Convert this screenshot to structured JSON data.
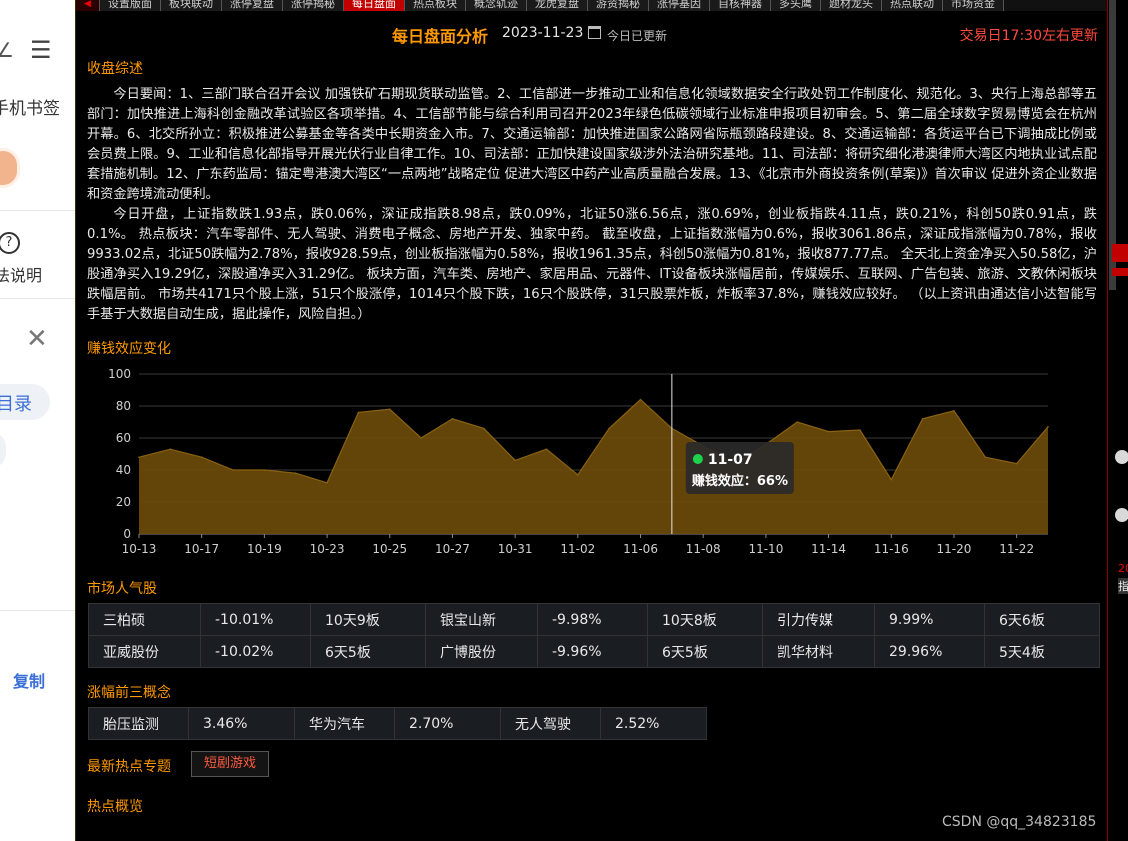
{
  "left_panel": {
    "menu_icon": "menu-icon",
    "bookmark_text": "手机书签",
    "help_text": "法说明",
    "close_icon": "close-icon",
    "catalog_text": "目录",
    "copy_text": "复制"
  },
  "tabs": [
    "设置版面",
    "板块联动",
    "涨停复盘",
    "涨停揭秘",
    "每日盘面",
    "热点板块",
    "概念轨迹",
    "龙虎复盘",
    "游资揭秘",
    "涨停基因",
    "自核神器",
    "多头鹰",
    "题材龙头",
    "热点联动",
    "市场资金"
  ],
  "active_tab": 4,
  "header": {
    "title": "每日盘面分析",
    "date": "2023-11-23",
    "updated": "今日已更新",
    "update_note": "交易日17:30左右更新"
  },
  "summary": {
    "title": "收盘综述",
    "news": "今日要闻：1、三部门联合召开会议 加强铁矿石期现货联动监管。2、工信部进一步推动工业和信息化领域数据安全行政处罚工作制度化、规范化。3、央行上海总部等五部门：加快推进上海科创金融改革试验区各项举措。4、工信部节能与综合利用司召开2023年绿色低碳领域行业标准申报项目初审会。5、第二届全球数字贸易博览会在杭州开幕。6、北交所孙立：积极推进公募基金等各类中长期资金入市。7、交通运输部：加快推进国家公路网省际瓶颈路段建设。8、交通运输部：各货运平台已下调抽成比例或会员费上限。9、工业和信息化部指导开展光伏行业自律工作。10、司法部：正加快建设国家级涉外法治研究基地。11、司法部：将研究细化港澳律师大湾区内地执业试点配套措施机制。12、广东药监局：锚定粤港澳大湾区“一点两地”战略定位 促进大湾区中药产业高质量融合发展。13、《北京市外商投资条例(草案)》首次审议 促进外资企业数据和资金跨境流动便利。",
    "market": "今日开盘，上证指数跌1.93点，跌0.06%，深证成指跌8.98点，跌0.09%，北证50涨6.56点，涨0.69%，创业板指跌4.11点，跌0.21%，科创50跌0.91点，跌0.1%。 热点板块：汽车零部件、无人驾驶、消费电子概念、房地产开发、独家中药。 截至收盘，上证指数涨幅为0.6%，报收3061.86点，深证成指涨幅为0.78%，报收9933.02点，北证50跌幅为2.78%，报收928.59点，创业板指涨幅为0.58%，报收1961.35点，科创50涨幅为0.81%，报收877.77点。 全天北上资金净买入50.58亿，沪股通净买入19.29亿，深股通净买入31.29亿。 板块方面，汽车类、房地产、家居用品、元器件、IT设备板块涨幅居前，传媒娱乐、互联网、广告包装、旅游、文教休闲板块跌幅居前。 市场共4171只个股上涨，51只个股涨停，1014只个股下跌，16只个股跌停，31只股票炸板，炸板率37.8%，赚钱效应较好。 （以上资讯由通达信小达智能写手基于大数据自动生成，据此操作，风险自担。）"
  },
  "chart_section": {
    "title": "赚钱效应变化"
  },
  "chart_data": {
    "type": "area",
    "x": [
      "10-13",
      "10-16",
      "10-17",
      "10-18",
      "10-19",
      "10-20",
      "10-23",
      "10-24",
      "10-25",
      "10-26",
      "10-27",
      "10-30",
      "10-31",
      "11-01",
      "11-02",
      "11-03",
      "11-06",
      "11-07",
      "11-08",
      "11-09",
      "11-10",
      "11-13",
      "11-14",
      "11-15",
      "11-16",
      "11-17",
      "11-20",
      "11-21",
      "11-22",
      "11-23"
    ],
    "y": [
      48,
      53,
      48,
      40,
      40,
      38,
      32,
      76,
      78,
      60,
      72,
      66,
      46,
      53,
      37,
      66,
      84,
      66,
      55,
      44,
      56,
      70,
      64,
      65,
      34,
      72,
      77,
      48,
      44,
      67
    ],
    "xticks": [
      "10-13",
      "10-17",
      "10-19",
      "10-23",
      "10-25",
      "10-27",
      "10-31",
      "11-02",
      "11-06",
      "11-08",
      "11-10",
      "11-14",
      "11-16",
      "11-20",
      "11-22"
    ],
    "yticks": [
      0,
      20,
      40,
      60,
      80,
      100
    ],
    "ylim": [
      0,
      100
    ],
    "grid": true,
    "tooltip": {
      "date": "11-07",
      "label": "赚钱效应：",
      "value": "66%"
    },
    "fill_color": "#6b4a0a",
    "line_color": "#8a6212"
  },
  "popularity": {
    "title": "市场人气股",
    "rows": [
      [
        {
          "name": "三柏硕",
          "change": "-10.01%",
          "board": "10天9板"
        },
        {
          "name": "银宝山新",
          "change": "-9.98%",
          "board": "10天8板"
        },
        {
          "name": "引力传媒",
          "change": "9.99%",
          "board": "6天6板"
        }
      ],
      [
        {
          "name": "亚威股份",
          "change": "-10.02%",
          "board": "6天5板"
        },
        {
          "name": "广博股份",
          "change": "-9.96%",
          "board": "6天5板"
        },
        {
          "name": "凯华材料",
          "change": "29.96%",
          "board": "5天4板"
        }
      ]
    ]
  },
  "concepts": {
    "title": "涨幅前三概念",
    "items": [
      {
        "name": "胎压监测",
        "change": "3.46%"
      },
      {
        "name": "华为汽车",
        "change": "2.70%"
      },
      {
        "name": "无人驾驶",
        "change": "2.52%"
      }
    ]
  },
  "hot_topics": {
    "title": "最新热点专题",
    "tag": "短剧游戏"
  },
  "hot_overview": {
    "title": "热点概览"
  },
  "watermark": "CSDN @qq_34823185",
  "right_strip": {
    "label_1": "20",
    "label_2": "指"
  },
  "colors": {
    "accent": "#ff9900",
    "up": "#ff3b3b",
    "down": "#2ec15c",
    "background": "#000000"
  }
}
